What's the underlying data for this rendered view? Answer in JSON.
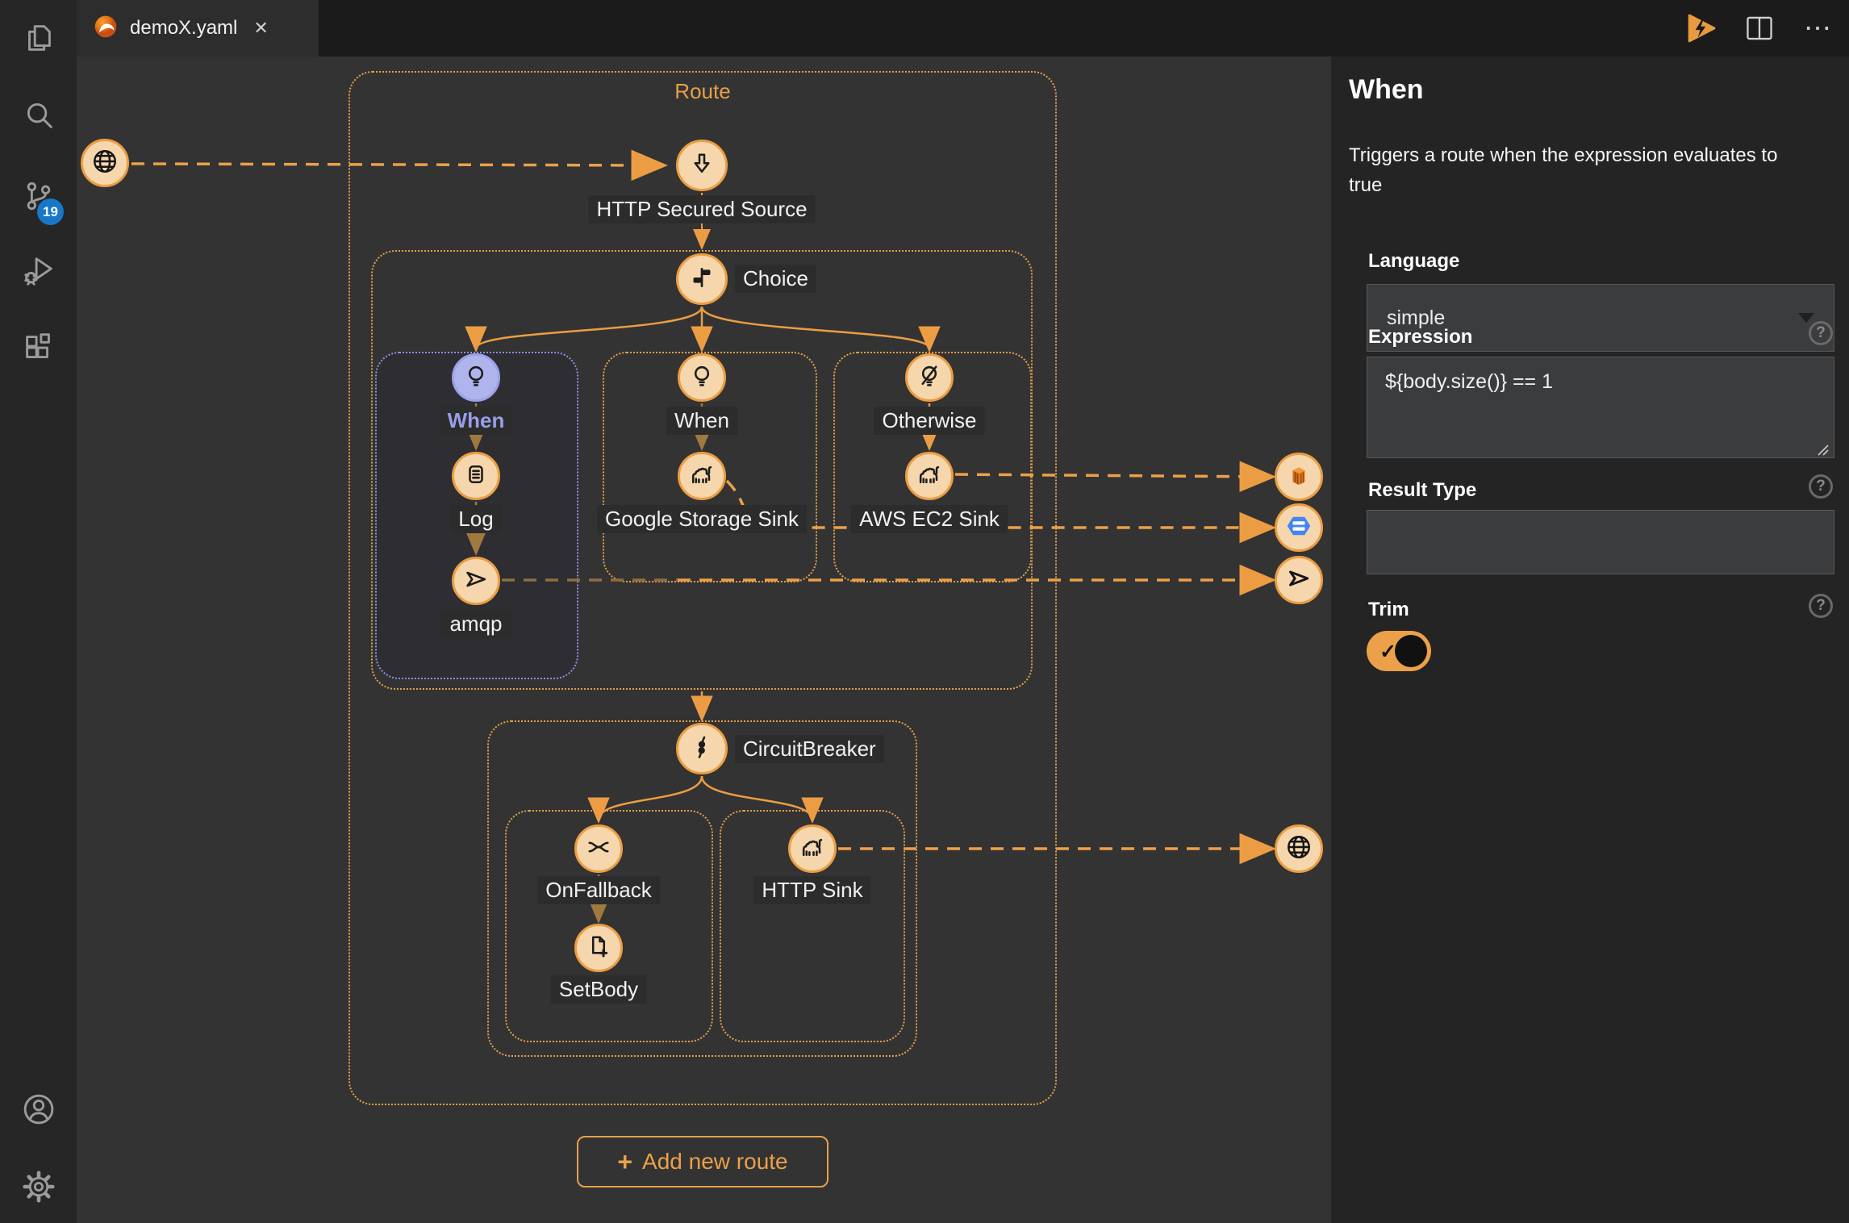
{
  "tab": {
    "title": "demoX.yaml",
    "close_glyph": "✕"
  },
  "topbar": {
    "more_glyph": "⋯"
  },
  "activity_bar": {
    "scm_badge": "19"
  },
  "canvas": {
    "route_label": "Route",
    "add_route_label": "Add new route",
    "add_route_plus": "+",
    "nodes": {
      "http_source": "HTTP Secured Source",
      "choice": "Choice",
      "when1": "When",
      "log": "Log",
      "amqp": "amqp",
      "when2": "When",
      "google_storage": "Google Storage Sink",
      "otherwise": "Otherwise",
      "aws_ec2": "AWS EC2 Sink",
      "circuit_breaker": "CircuitBreaker",
      "on_fallback": "OnFallback",
      "set_body": "SetBody",
      "http_sink": "HTTP Sink"
    }
  },
  "panel": {
    "title": "When",
    "description": "Triggers a route when the expression evaluates to true",
    "language_label": "Language",
    "language_value": "simple",
    "expression_label": "Expression",
    "expression_value": "${body.size()} == 1",
    "result_type_label": "Result Type",
    "result_type_value": "",
    "trim_label": "Trim",
    "trim_check_glyph": "✓",
    "help_glyph": "?"
  }
}
